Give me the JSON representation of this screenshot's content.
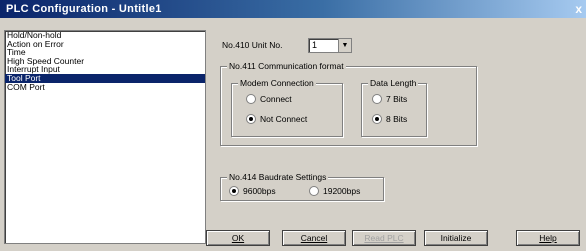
{
  "window": {
    "title": "PLC Configuration - Untitle1",
    "close": "x"
  },
  "list": {
    "items": [
      "Hold/Non-hold",
      "Action on Error",
      "Time",
      "High Speed Counter",
      "Interrupt Input",
      "Tool Port",
      "COM Port"
    ],
    "selected": "Tool Port"
  },
  "unit": {
    "label": "No.410 Unit No.",
    "value": "1"
  },
  "comm": {
    "legend": "No.411 Communication format",
    "modem": {
      "legend": "Modem Connection",
      "options": [
        "Connect",
        "Not Connect"
      ],
      "selected": "Not Connect"
    },
    "datalen": {
      "legend": "Data Length",
      "options": [
        "7 Bits",
        "8 Bits"
      ],
      "selected": "8 Bits"
    }
  },
  "baud": {
    "legend": "No.414 Baudrate Settings",
    "options": [
      "9600bps",
      "19200bps"
    ],
    "selected": "9600bps"
  },
  "buttons": {
    "ok": "OK",
    "cancel": "Cancel",
    "read": "Read PLC",
    "init": "Initialize",
    "help": "Help"
  }
}
